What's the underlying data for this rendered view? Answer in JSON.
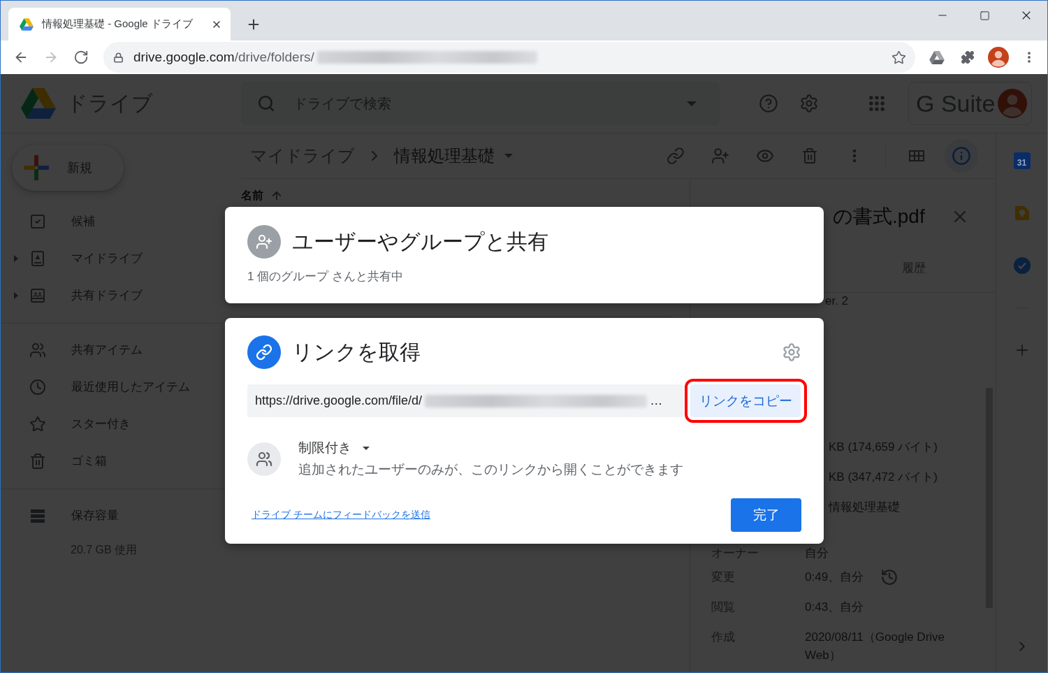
{
  "browser": {
    "tab": {
      "title": "情報処理基礎 - Google ドライブ"
    },
    "nav_buttons": [
      {
        "kind": "back",
        "disabled": false
      },
      {
        "kind": "forward",
        "disabled": true
      },
      {
        "kind": "reload",
        "disabled": false
      }
    ],
    "address": {
      "host": "drive.google.com",
      "path": "/drive/folders/",
      "redacted": true
    }
  },
  "drive": {
    "app_name": "ドライブ",
    "search": {
      "placeholder": "ドライブで検索"
    },
    "suite_label": "G Suite",
    "new_button": "新規",
    "nav_groups": [
      [
        {
          "label": "候補",
          "kind": "suggested",
          "expandable": false,
          "selected": false
        },
        {
          "label": "マイドライブ",
          "kind": "my-drive",
          "expandable": true,
          "selected": false
        },
        {
          "label": "共有ドライブ",
          "kind": "shared-drives",
          "expandable": true,
          "selected": false
        }
      ],
      [
        {
          "label": "共有アイテム",
          "kind": "shared",
          "expandable": false,
          "selected": false
        },
        {
          "label": "最近使用したアイテム",
          "kind": "recent",
          "expandable": false,
          "selected": false
        },
        {
          "label": "スター付き",
          "kind": "starred",
          "expandable": false,
          "selected": false
        },
        {
          "label": "ゴミ箱",
          "kind": "trash",
          "expandable": false,
          "selected": false
        }
      ],
      [
        {
          "label": "保存容量",
          "kind": "storage",
          "expandable": false,
          "selected": false
        }
      ]
    ],
    "storage_usage": "20.7 GB 使用",
    "breadcrumb": [
      {
        "label": "マイドライブ"
      },
      {
        "label": "情報処理基礎"
      }
    ],
    "view_buttons": [
      {
        "kind": "grid",
        "selected": false
      },
      {
        "kind": "info",
        "selected": true
      }
    ],
    "list_header": {
      "label": "名前"
    },
    "details": {
      "title": "の書式.pdf",
      "tabs": [
        {
          "label": "履歴",
          "selected": false
        }
      ],
      "version": "er. 2",
      "rows": [
        {
          "kind": "plain",
          "value": "KB (174,659 バイト)"
        },
        {
          "kind": "plain",
          "value": "KB (347,472 バイト)"
        },
        {
          "kind": "plain",
          "value": "情報処理基礎"
        },
        {
          "kind": "plain",
          "label": "オーナー",
          "value": "自分"
        },
        {
          "kind": "history",
          "label": "変更",
          "value": "0:49、自分"
        },
        {
          "kind": "plain",
          "label": "閲覧",
          "value": "0:43、自分"
        },
        {
          "kind": "plain",
          "label": "作成",
          "value": "2020/08/11（Google Drive Web）"
        }
      ]
    },
    "side_apps": [
      {
        "kind": "calendar",
        "day": "31"
      },
      {
        "kind": "keep"
      },
      {
        "kind": "tasks"
      }
    ]
  },
  "share_dialog": {
    "people_card": {
      "title": "ユーザーやグループと共有",
      "subtitle": "1 個のグループ さんと共有中"
    },
    "link_card": {
      "title": "リンクを取得",
      "link": {
        "value": "https://drive.google.com/file/d/",
        "redacted": true,
        "overflow": "…"
      },
      "copy_button": {
        "label": "リンクをコピー",
        "highlighted": true
      },
      "access": {
        "label": "制限付き",
        "description": "追加されたユーザーのみが、このリンクから開くことができます"
      },
      "feedback_link": "ドライブ チームにフィードバックを送信",
      "done_button": "完了"
    }
  }
}
